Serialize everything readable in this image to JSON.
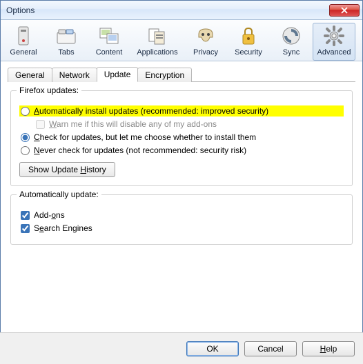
{
  "window": {
    "title": "Options"
  },
  "toolbar": {
    "items": [
      {
        "label": "General"
      },
      {
        "label": "Tabs"
      },
      {
        "label": "Content"
      },
      {
        "label": "Applications"
      },
      {
        "label": "Privacy"
      },
      {
        "label": "Security"
      },
      {
        "label": "Sync"
      },
      {
        "label": "Advanced"
      }
    ],
    "selected": "Advanced"
  },
  "subtabs": {
    "items": [
      "General",
      "Network",
      "Update",
      "Encryption"
    ],
    "active": "Update"
  },
  "update": {
    "group1_title": "Firefox updates:",
    "opt_auto": "Automatically install updates (recommended: improved security)",
    "opt_auto_warn": "Warn me if this will disable any of my add-ons",
    "opt_check": "Check for updates, but let me choose whether to install them",
    "opt_never": "Never check for updates (not recommended: security risk)",
    "history_btn": "Show Update History",
    "group2_title": "Automatically update:",
    "chk_addons": "Add-ons",
    "chk_search": "Search Engines"
  },
  "buttons": {
    "ok": "OK",
    "cancel": "Cancel",
    "help": "Help"
  }
}
